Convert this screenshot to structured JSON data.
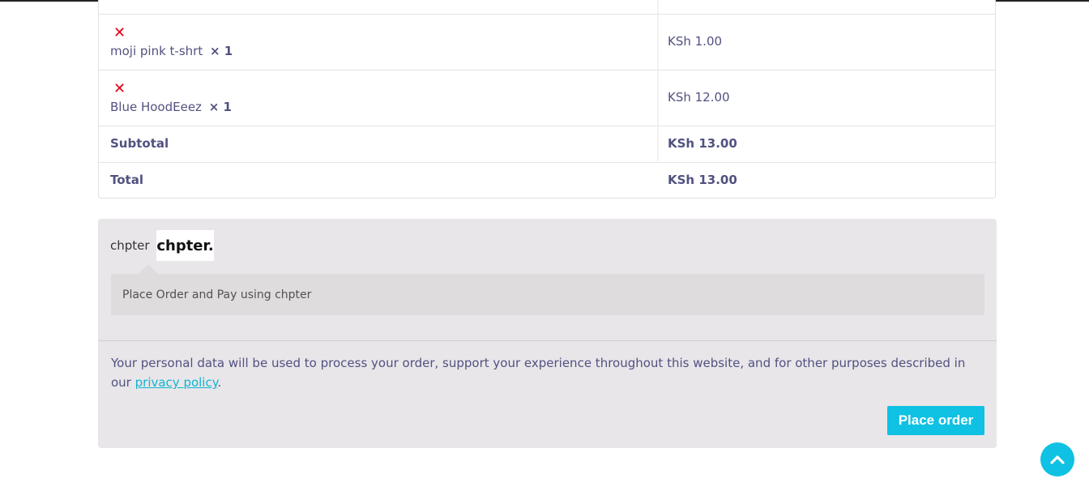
{
  "order_review": {
    "items": [
      {
        "remove_glyph": "✕",
        "name": "moji pink t-shrt",
        "qty": "× 1",
        "price": "KSh 1.00"
      },
      {
        "remove_glyph": "✕",
        "name": "Blue HoodEeez",
        "qty": "× 1",
        "price": "KSh 12.00"
      }
    ],
    "subtotal_label": "Subtotal",
    "subtotal_value": "KSh 13.00",
    "total_label": "Total",
    "total_value": "KSh 13.00"
  },
  "payment": {
    "method_label": "chpter",
    "method_logo_text": "chpter.",
    "description": "Place Order and Pay using chpter",
    "privacy_text": "Your personal data will be used to process your order, support your experience throughout this website, and for other purposes described in our ",
    "privacy_link": "privacy policy",
    "privacy_suffix": ".",
    "place_order_label": "Place order"
  },
  "colors": {
    "accent": "#0fc1e2",
    "remove": "#e2001a",
    "text": "#515181",
    "panel": "#e8e6e9"
  },
  "icons": {
    "remove": "x-icon",
    "scroll_top": "chevron-up-icon"
  }
}
